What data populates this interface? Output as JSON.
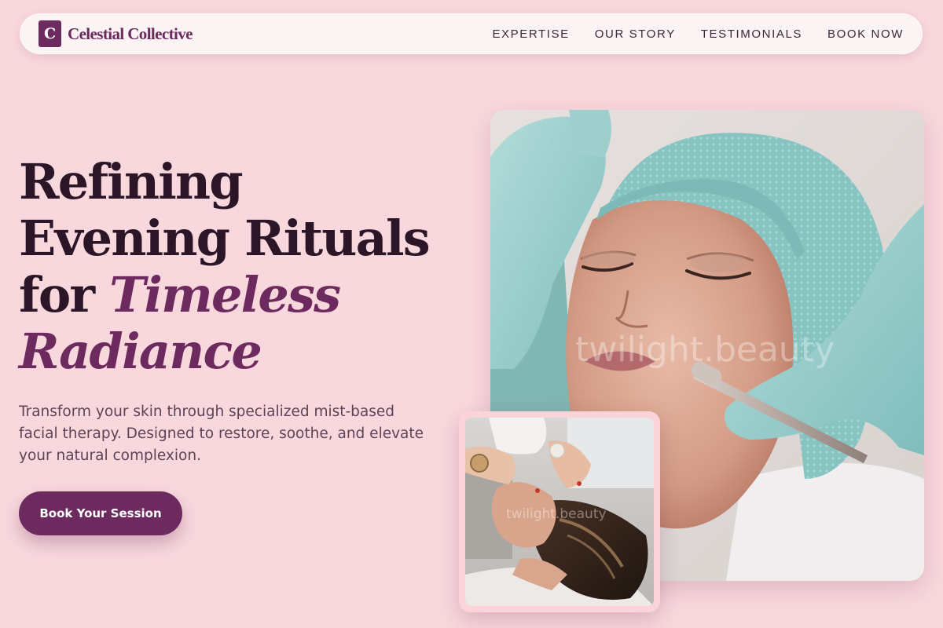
{
  "nav": {
    "logo_mark": "C",
    "brand": "Celestial Collective",
    "links": [
      {
        "label": "EXPERTISE"
      },
      {
        "label": "OUR STORY"
      },
      {
        "label": "TESTIMONIALS"
      },
      {
        "label": "BOOK NOW"
      }
    ]
  },
  "hero": {
    "title_line1": "Refining",
    "title_line2": "Evening Rituals",
    "title_line3_plain": "for ",
    "title_line3_accent": "Timeless",
    "title_line4_accent": "Radiance",
    "description": "Transform your skin through specialized mist-based facial therapy. Designed to restore, soothe, and elevate your natural complexion.",
    "cta_label": "Book Your Session"
  },
  "images": {
    "main_watermark": "twilight.beauty",
    "small_watermark": "twilight.beauty"
  },
  "colors": {
    "background": "#f9d8dd",
    "accent": "#6d2a5f",
    "heading": "#2b1628"
  }
}
